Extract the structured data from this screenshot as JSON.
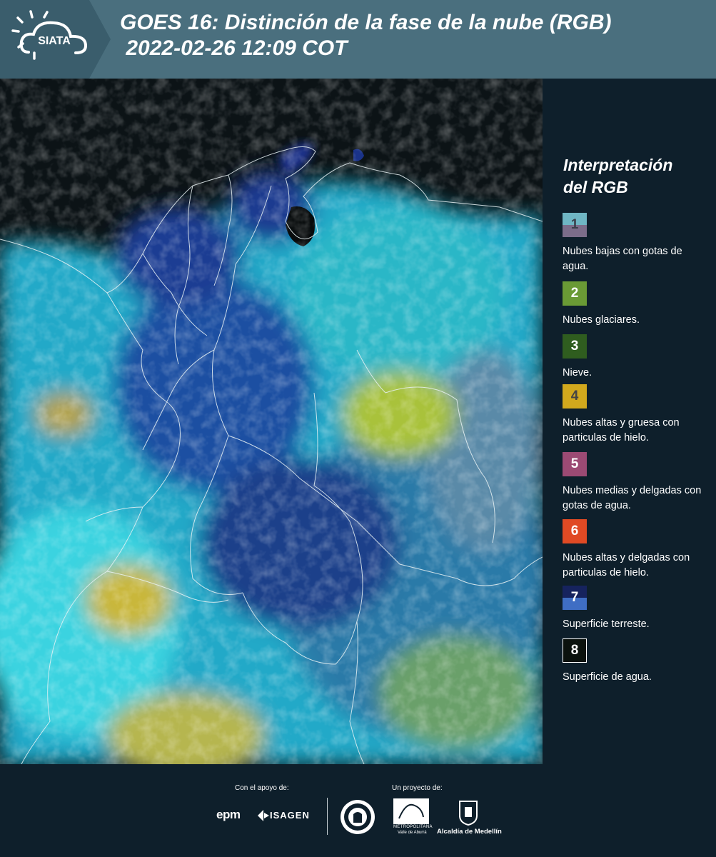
{
  "header": {
    "logo_text": "SIATA",
    "title": "GOES 16: Distinción de la fase de la nube (RGB)\n 2022-02-26 12:09 COT"
  },
  "legend": {
    "title": "Interpretación del RGB",
    "items": [
      {
        "number": "1",
        "label": "Nubes bajas con gotas de agua.",
        "color_top": "#6fb6c4",
        "color_bottom": "#7c6d8a"
      },
      {
        "number": "2",
        "label": "Nubes glaciares.",
        "color": "#6a9a35"
      },
      {
        "number": "3",
        "label": "Nieve.",
        "color": "#2f5d1f"
      },
      {
        "number": "4",
        "label": "Nubes altas y gruesa con particulas de hielo.",
        "color": "#d2a91d"
      },
      {
        "number": "5",
        "label": "Nubes medias y delgadas con gotas de agua.",
        "color": "#9c4a74"
      },
      {
        "number": "6",
        "label": "Nubes altas y delgadas con particulas de hielo.",
        "color": "#e04a24"
      },
      {
        "number": "7",
        "label": "Superficie terreste.",
        "color_top": "#16235e",
        "color_bottom": "#3f6ec4"
      },
      {
        "number": "8",
        "label": "Superficie de agua.",
        "color": "#0b120e"
      }
    ]
  },
  "footer": {
    "support_label": "Con el apoyo de:",
    "project_label": "Un proyecto de:",
    "sponsor_epm": "epm",
    "sponsor_isagen": "ISAGEN",
    "partner_area_line1": "METROPOLITANA",
    "partner_area_line2": "Valle de Aburrá",
    "partner_alcaldia": "Alcaldía de Medellín"
  }
}
